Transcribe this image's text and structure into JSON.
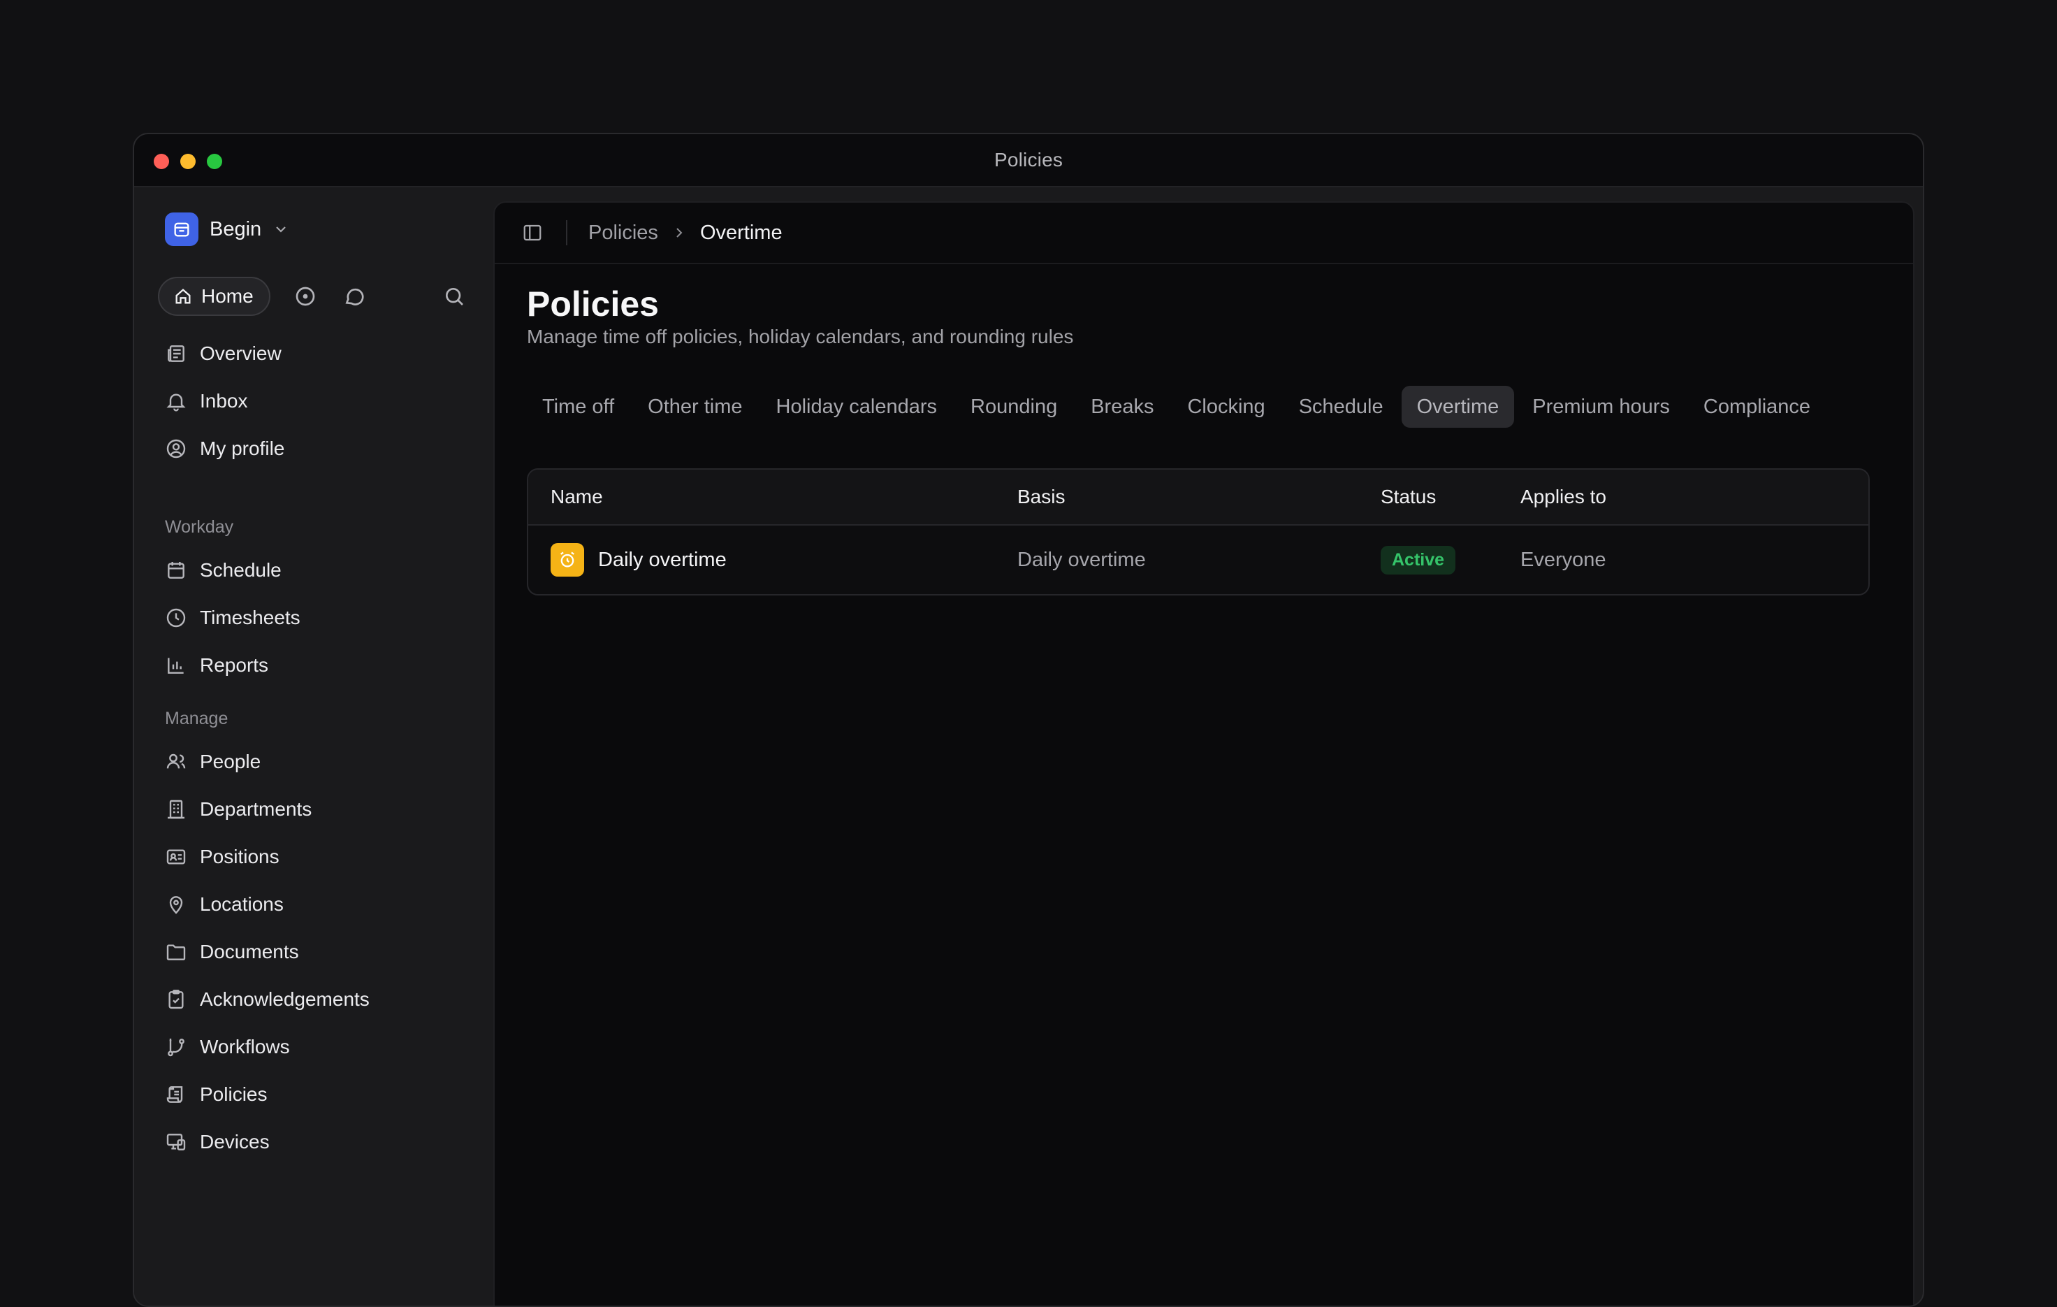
{
  "window": {
    "title": "Policies"
  },
  "workspace": {
    "name": "Begin"
  },
  "topbar": {
    "home_label": "Home"
  },
  "nav": {
    "primary": [
      {
        "label": "Overview",
        "icon": "newspaper-icon"
      },
      {
        "label": "Inbox",
        "icon": "bell-icon"
      },
      {
        "label": "My profile",
        "icon": "user-circle-icon"
      }
    ],
    "sections": [
      {
        "title": "Workday",
        "items": [
          {
            "label": "Schedule",
            "icon": "calendar-icon"
          },
          {
            "label": "Timesheets",
            "icon": "clock-icon"
          },
          {
            "label": "Reports",
            "icon": "bar-chart-icon"
          }
        ]
      },
      {
        "title": "Manage",
        "items": [
          {
            "label": "People",
            "icon": "users-icon"
          },
          {
            "label": "Departments",
            "icon": "building-icon"
          },
          {
            "label": "Positions",
            "icon": "id-card-icon"
          },
          {
            "label": "Locations",
            "icon": "map-pin-icon"
          },
          {
            "label": "Documents",
            "icon": "folder-icon"
          },
          {
            "label": "Acknowledgements",
            "icon": "clipboard-check-icon"
          },
          {
            "label": "Workflows",
            "icon": "git-branch-icon"
          },
          {
            "label": "Policies",
            "icon": "scroll-icon"
          },
          {
            "label": "Devices",
            "icon": "devices-icon"
          }
        ]
      }
    ]
  },
  "breadcrumb": {
    "parent": "Policies",
    "current": "Overtime"
  },
  "page": {
    "title": "Policies",
    "subtitle": "Manage time off policies, holiday calendars, and rounding rules"
  },
  "tabs": [
    {
      "label": "Time off",
      "active": false
    },
    {
      "label": "Other time",
      "active": false
    },
    {
      "label": "Holiday calendars",
      "active": false
    },
    {
      "label": "Rounding",
      "active": false
    },
    {
      "label": "Breaks",
      "active": false
    },
    {
      "label": "Clocking",
      "active": false
    },
    {
      "label": "Schedule",
      "active": false
    },
    {
      "label": "Overtime",
      "active": true
    },
    {
      "label": "Premium hours",
      "active": false
    },
    {
      "label": "Compliance",
      "active": false
    }
  ],
  "table": {
    "headers": {
      "name": "Name",
      "basis": "Basis",
      "status": "Status",
      "applies": "Applies to"
    },
    "rows": [
      {
        "name": "Daily overtime",
        "basis": "Daily overtime",
        "status": "Active",
        "applies": "Everyone",
        "icon": "alarm-clock-icon"
      }
    ]
  },
  "colors": {
    "accent": "#3f63e6",
    "row_icon_bg": "#f5b316",
    "status_active": "#35c46a"
  }
}
